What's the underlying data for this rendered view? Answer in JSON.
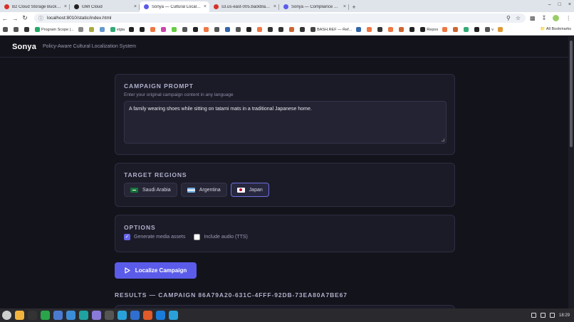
{
  "browser": {
    "tabs": [
      {
        "title": "B2 Cloud Storage Buckets",
        "color": "#d93025",
        "active": false
      },
      {
        "title": "GMI Cloud",
        "color": "#222222",
        "active": false
      },
      {
        "title": "Sonya — Cultural Localiza",
        "color": "#5b5bea",
        "active": true
      },
      {
        "title": "s3.us-east-005.backblazeb2",
        "color": "#d93025",
        "active": false
      },
      {
        "title": "Sonya — Compliance Notary",
        "color": "#5b5bea",
        "active": false
      }
    ],
    "new_tab_glyph": "+",
    "url": "localhost:8010/static/index.html",
    "bookmarks": [
      {
        "label": "",
        "color": "#555"
      },
      {
        "label": "",
        "color": "#333"
      },
      {
        "label": "Program Scope |...",
        "color": "#2a6"
      },
      {
        "label": "",
        "color": "#888"
      },
      {
        "label": "",
        "color": "#aa4"
      },
      {
        "label": "",
        "color": "#69c"
      },
      {
        "label": "vigia",
        "color": "#3a7"
      },
      {
        "label": "",
        "color": "#222"
      },
      {
        "label": "",
        "color": "#222"
      },
      {
        "label": "",
        "color": "#e74"
      },
      {
        "label": "",
        "color": "#c4a"
      },
      {
        "label": "",
        "color": "#6c4"
      },
      {
        "label": "",
        "color": "#555"
      },
      {
        "label": "",
        "color": "#222"
      },
      {
        "label": "",
        "color": "#e74"
      },
      {
        "label": "",
        "color": "#555"
      },
      {
        "label": "",
        "color": "#36a"
      },
      {
        "label": "",
        "color": "#555"
      },
      {
        "label": "",
        "color": "#222"
      },
      {
        "label": "",
        "color": "#e74"
      },
      {
        "label": "",
        "color": "#333"
      },
      {
        "label": "",
        "color": "#333"
      },
      {
        "label": "",
        "color": "#c63"
      },
      {
        "label": "",
        "color": "#333"
      },
      {
        "label": "BASH.REF — Ref...",
        "color": "#444"
      },
      {
        "label": "",
        "color": "#36a"
      },
      {
        "label": "",
        "color": "#e74"
      },
      {
        "label": "",
        "color": "#333"
      },
      {
        "label": "",
        "color": "#e74"
      },
      {
        "label": "",
        "color": "#c63"
      },
      {
        "label": "",
        "color": "#222"
      },
      {
        "label": "Repos",
        "color": "#222"
      },
      {
        "label": "",
        "color": "#e74"
      },
      {
        "label": "",
        "color": "#c63"
      },
      {
        "label": "",
        "color": "#3a7"
      },
      {
        "label": "",
        "color": "#222"
      },
      {
        "label": "v",
        "color": "#555"
      },
      {
        "label": "",
        "color": "#d93"
      }
    ],
    "all_bookmarks_label": "All Bookmarks"
  },
  "app": {
    "logo": "Sonya",
    "tagline": "Policy-Aware Cultural Localization System"
  },
  "prompt": {
    "title": "CAMPAIGN PROMPT",
    "subtitle": "Enter your original campaign content in any language",
    "value": "A family wearing shoes while sitting on tatami mats in a traditional Japanese home."
  },
  "regions": {
    "title": "TARGET REGIONS",
    "items": [
      {
        "label": "Saudi Arabia",
        "flag": "sa",
        "selected": false
      },
      {
        "label": "Argentina",
        "flag": "ar",
        "selected": false
      },
      {
        "label": "Japan",
        "flag": "jp",
        "selected": true
      }
    ]
  },
  "options": {
    "title": "OPTIONS",
    "media_label": "Generate media assets",
    "media_checked": true,
    "audio_label": "Include audio (TTS)",
    "audio_checked": false
  },
  "action": {
    "localize_label": "Localize Campaign"
  },
  "results": {
    "title": "RESULTS — CAMPAIGN 86A79A20-631C-4FFF-92DB-73EA80A7BE67"
  },
  "taskbar": {
    "apps": [
      "#cfcfcf",
      "#f2b33d",
      "#333",
      "#2aa44a",
      "#4a7bd0",
      "#3c8dd8",
      "#1fa3a0",
      "#8a7ad8",
      "#555",
      "#2aa0d8",
      "#2f6fd0",
      "#e05a2a",
      "#1a7bd8",
      "#2aa0d8"
    ],
    "clock": "18:29"
  },
  "colors": {
    "accent": "#5b5bea",
    "page_bg": "#13131b",
    "card_bg": "#1b1b28"
  }
}
